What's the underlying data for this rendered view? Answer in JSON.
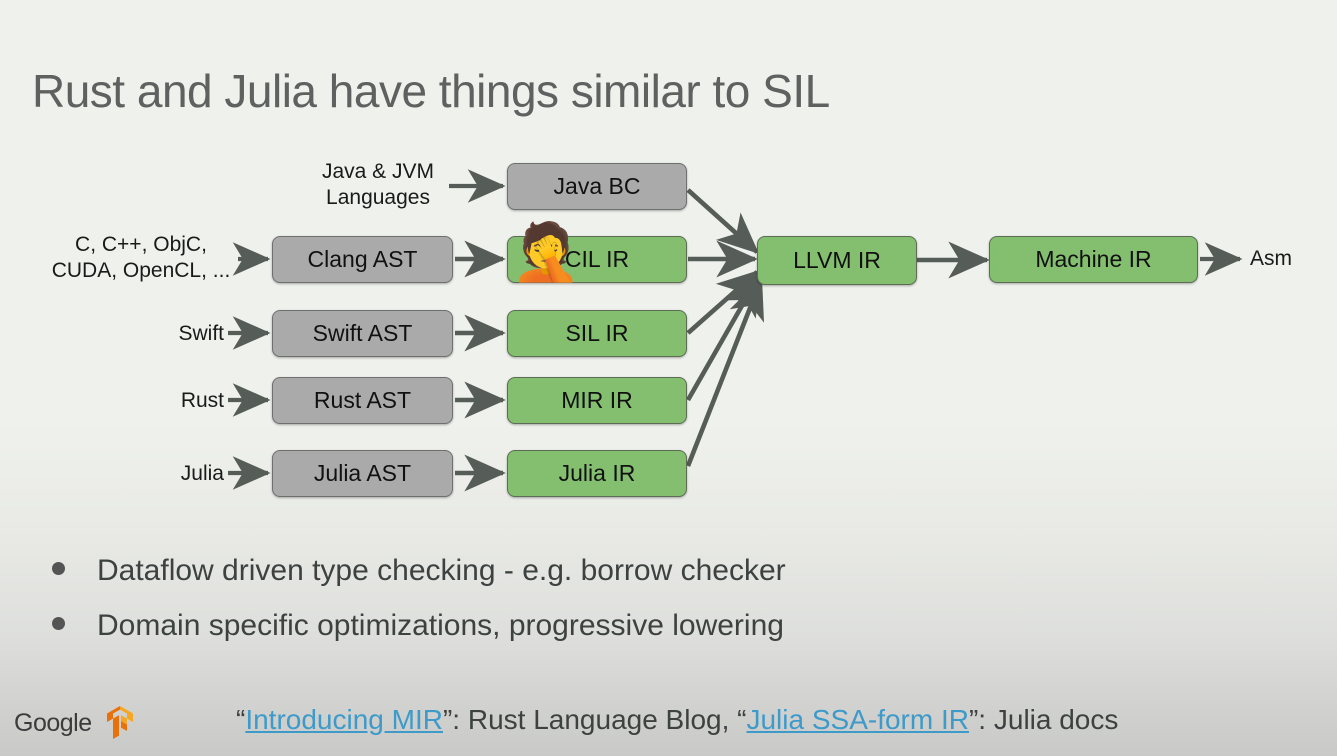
{
  "slide": {
    "title": "Rust and Julia have things similar to SIL",
    "background_top": "#eff1ec",
    "background_bottom": "#c9cac7",
    "title_color": "#5e6160"
  },
  "diagram": {
    "gray_fill": "#aaaaaa",
    "green_fill": "#84be6f",
    "arrow_color": "#565c57",
    "emoji": "🤦",
    "emoji_name": "person-facepalming-emoji",
    "source_labels": [
      {
        "id": "java",
        "lines": "Java & JVM\nLanguages"
      },
      {
        "id": "c",
        "lines": "C, C++, ObjC,\nCUDA, OpenCL, ..."
      },
      {
        "id": "swift",
        "lines": "Swift"
      },
      {
        "id": "rust",
        "lines": "Rust"
      },
      {
        "id": "julia",
        "lines": "Julia"
      }
    ],
    "ast_nodes": [
      {
        "id": "clang-ast",
        "label": "Clang AST",
        "color": "gray"
      },
      {
        "id": "swift-ast",
        "label": "Swift AST",
        "color": "gray"
      },
      {
        "id": "rust-ast",
        "label": "Rust AST",
        "color": "gray"
      },
      {
        "id": "julia-ast",
        "label": "Julia AST",
        "color": "gray"
      }
    ],
    "ir_nodes": [
      {
        "id": "java-bc",
        "label": "Java BC",
        "color": "gray"
      },
      {
        "id": "cil-ir",
        "label": "CIL IR",
        "color": "green"
      },
      {
        "id": "sil-ir",
        "label": "SIL IR",
        "color": "green"
      },
      {
        "id": "mir-ir",
        "label": "MIR IR",
        "color": "green"
      },
      {
        "id": "julia-ir",
        "label": "Julia IR",
        "color": "green"
      }
    ],
    "backend_nodes": [
      {
        "id": "llvm-ir",
        "label": "LLVM IR",
        "color": "green"
      },
      {
        "id": "machine-ir",
        "label": "Machine IR",
        "color": "green"
      }
    ],
    "output_label": "Asm"
  },
  "bullets": [
    "Dataflow driven type checking - e.g. borrow checker",
    "Domain specific optimizations, progressive lowering"
  ],
  "footer": {
    "google_wordmark": "Google",
    "tensorflow_logo": "tensorflow-logo",
    "citation": {
      "open_quote_1": "“",
      "link1": "Introducing MIR",
      "mid": "”: Rust Language Blog, “",
      "link2": "Julia SSA-form IR",
      "tail": "”: Julia docs"
    },
    "link_color": "#3d9ac9"
  }
}
